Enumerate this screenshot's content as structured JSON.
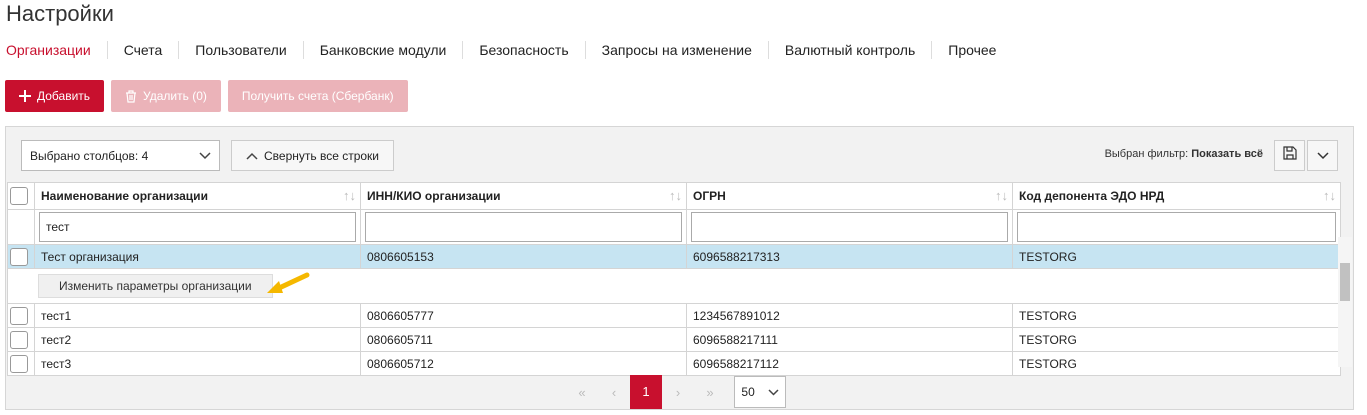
{
  "page": {
    "title": "Настройки"
  },
  "tabs": [
    {
      "label": "Организации"
    },
    {
      "label": "Счета"
    },
    {
      "label": "Пользователи"
    },
    {
      "label": "Банковские модули"
    },
    {
      "label": "Безопасность"
    },
    {
      "label": "Запросы на изменение"
    },
    {
      "label": "Валютный контроль"
    },
    {
      "label": "Прочее"
    }
  ],
  "toolbar": {
    "add_label": "Добавить",
    "delete_label": "Удалить (0)",
    "get_accounts_label": "Получить счета (Сбербанк)"
  },
  "grid": {
    "columns_select": "Выбрано столбцов: 4",
    "collapse_label": "Свернуть все строки",
    "filter_prefix": "Выбран фильтр:",
    "filter_value": "Показать всё",
    "headers": [
      "Наименование организации",
      "ИНН/КИО организации",
      "ОГРН",
      "Код депонента ЭДО НРД"
    ],
    "filter_values": [
      "тест",
      "",
      "",
      ""
    ],
    "selected_row": [
      "Тест организация",
      "0806605153",
      "6096588217313",
      "TESTORG"
    ],
    "edit_button": "Изменить параметры организации",
    "rows": [
      [
        "тест1",
        "0806605777",
        "1234567891012",
        "TESTORG"
      ],
      [
        "тест2",
        "0806605711",
        "6096588217111",
        "TESTORG"
      ],
      [
        "тест3",
        "0806605712",
        "6096588217112",
        "TESTORG"
      ]
    ]
  },
  "pager": {
    "first": "«",
    "prev": "‹",
    "current": "1",
    "next": "›",
    "last": "»",
    "page_size": "50"
  },
  "colors": {
    "accent": "#c8102e",
    "selected_row": "#c6e4f2",
    "arrow": "#f5b800"
  }
}
